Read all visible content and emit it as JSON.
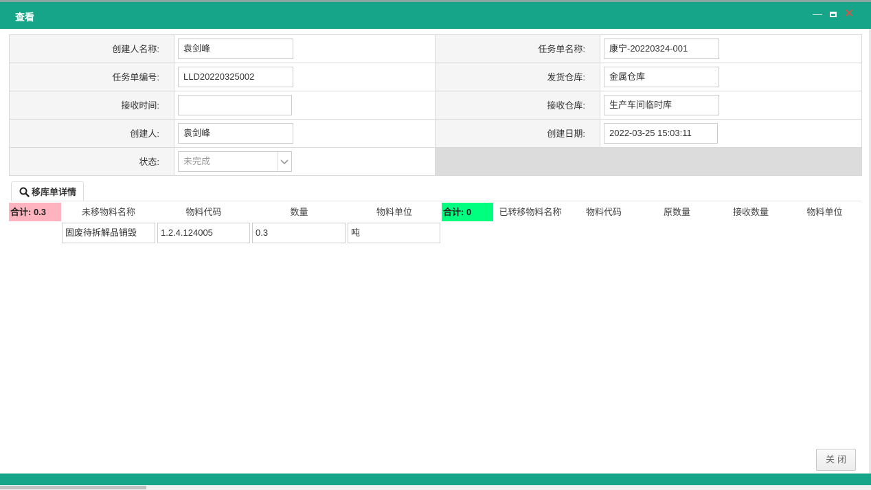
{
  "window": {
    "title": "查看",
    "min_glyph": "—",
    "close_glyph": "✕",
    "accent_color": "#17a589"
  },
  "form": {
    "creator_name_label": "创建人名称:",
    "creator_name_value": "袁剑峰",
    "task_name_label": "任务单名称:",
    "task_name_value": "康宁-20220324-001",
    "task_no_label": "任务单编号:",
    "task_no_value": "LLD20220325002",
    "ship_wh_label": "发货仓库:",
    "ship_wh_value": "金属仓库",
    "recv_time_label": "接收时间:",
    "recv_time_value": "",
    "recv_wh_label": "接收仓库:",
    "recv_wh_value": "生产车间临时库",
    "creator_label": "创建人:",
    "creator_value": "袁剑峰",
    "create_date_label": "创建日期:",
    "create_date_value": "2022-03-25 15:03:11",
    "status_label": "状态:",
    "status_value": "未完成"
  },
  "detail_tab": {
    "label": "移库单详情",
    "icon": "search-icon"
  },
  "left_table": {
    "total_label": "合计: 0.3",
    "headers": [
      "未移物料名称",
      "物料代码",
      "数量",
      "物料单位"
    ],
    "rows": [
      [
        "固废待拆解品销毁",
        "1.2.4.124005",
        "0.3",
        "吨"
      ]
    ],
    "total_color": "#ffb3be"
  },
  "right_table": {
    "total_label": "合计: 0",
    "headers": [
      "已转移物料名称",
      "物料代码",
      "原数量",
      "接收数量",
      "物料单位"
    ],
    "total_color": "#00ff7f"
  },
  "close_button": "关闭"
}
